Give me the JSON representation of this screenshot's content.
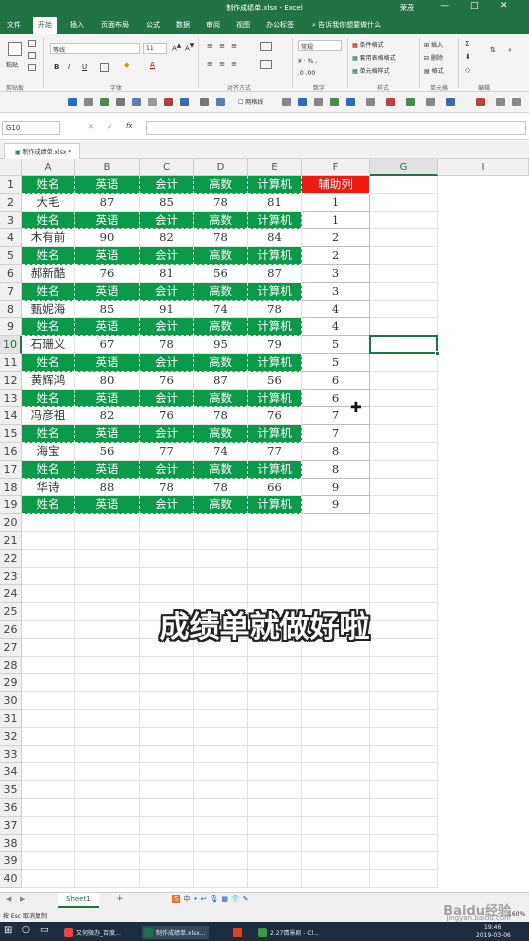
{
  "window": {
    "title": "制作成绩单.xlsx - Excel",
    "user": "荣茂",
    "min": "—",
    "max": "□",
    "close": "✕"
  },
  "tabs": [
    "文件",
    "开始",
    "插入",
    "页面布局",
    "公式",
    "数据",
    "审阅",
    "视图",
    "办公标签"
  ],
  "active_tab": "开始",
  "tell_me": "告诉我你想要做什么",
  "ribbon": {
    "paste": "粘贴",
    "font_name": "等线",
    "font_size": "11",
    "number_format": "常规",
    "groups": [
      "剪贴板",
      "字体",
      "对齐方式",
      "数字",
      "样式",
      "单元格",
      "编辑"
    ],
    "styles": [
      "条件格式",
      "套用表格格式",
      "单元格样式"
    ],
    "cells": [
      "插入",
      "删除",
      "格式"
    ],
    "bold": "B",
    "italic": "I",
    "underline": "U"
  },
  "qat": {
    "gridlines": "网格线"
  },
  "formula_bar": {
    "name_box": "G10",
    "fx": "fx",
    "cancel": "✕",
    "enter": "✓"
  },
  "doc_tab": "制作成绩单.xlsx *",
  "columns": [
    "A",
    "B",
    "C",
    "D",
    "E",
    "F",
    "G",
    "I"
  ],
  "selected_column": "G",
  "selected_row": "10",
  "rows": [
    [
      "姓名",
      "英语",
      "会计",
      "高数",
      "计算机",
      "辅助列"
    ],
    [
      "大毛",
      "87",
      "85",
      "78",
      "81",
      "1"
    ],
    [
      "姓名",
      "英语",
      "会计",
      "高数",
      "计算机",
      "1"
    ],
    [
      "木有前",
      "90",
      "82",
      "78",
      "84",
      "2"
    ],
    [
      "姓名",
      "英语",
      "会计",
      "高数",
      "计算机",
      "2"
    ],
    [
      "郝新酷",
      "76",
      "81",
      "56",
      "87",
      "3"
    ],
    [
      "姓名",
      "英语",
      "会计",
      "高数",
      "计算机",
      "3"
    ],
    [
      "甄妮海",
      "85",
      "91",
      "74",
      "78",
      "4"
    ],
    [
      "姓名",
      "英语",
      "会计",
      "高数",
      "计算机",
      "4"
    ],
    [
      "石珊义",
      "67",
      "78",
      "95",
      "79",
      "5"
    ],
    [
      "姓名",
      "英语",
      "会计",
      "高数",
      "计算机",
      "5"
    ],
    [
      "黄辉鸿",
      "80",
      "76",
      "87",
      "56",
      "6"
    ],
    [
      "姓名",
      "英语",
      "会计",
      "高数",
      "计算机",
      "6"
    ],
    [
      "冯彦祖",
      "82",
      "76",
      "78",
      "76",
      "7"
    ],
    [
      "姓名",
      "英语",
      "会计",
      "高数",
      "计算机",
      "7"
    ],
    [
      "海宝",
      "56",
      "77",
      "74",
      "77",
      "8"
    ],
    [
      "姓名",
      "英语",
      "会计",
      "高数",
      "计算机",
      "8"
    ],
    [
      "华诗",
      "88",
      "78",
      "78",
      "66",
      "9"
    ],
    [
      "姓名",
      "英语",
      "会计",
      "高数",
      "计算机",
      "9"
    ]
  ],
  "total_rows": 40,
  "caption": "成绩单就做好啦",
  "sheet_tab": "Sheet1",
  "add_sheet": "+",
  "ime": [
    "S",
    "中",
    "•",
    "↩",
    "🎙",
    "▦",
    "👕",
    "✎"
  ],
  "status": {
    "text": "按 Esc 取消复制",
    "zoom": "160%"
  },
  "taskbar": {
    "items": [
      "又何微办_百度...",
      "制作成绩单.xlsx...",
      "2.27情景剧 - Cl..."
    ],
    "time": "19:46",
    "date": "2019-03-06"
  },
  "watermark": {
    "main": "Baidu经验",
    "sub": "jingyan.baidu.com"
  },
  "colors": {
    "excel_green": "#217346",
    "header_green": "#0a9a4a",
    "helper_red": "#ee1c0f"
  }
}
